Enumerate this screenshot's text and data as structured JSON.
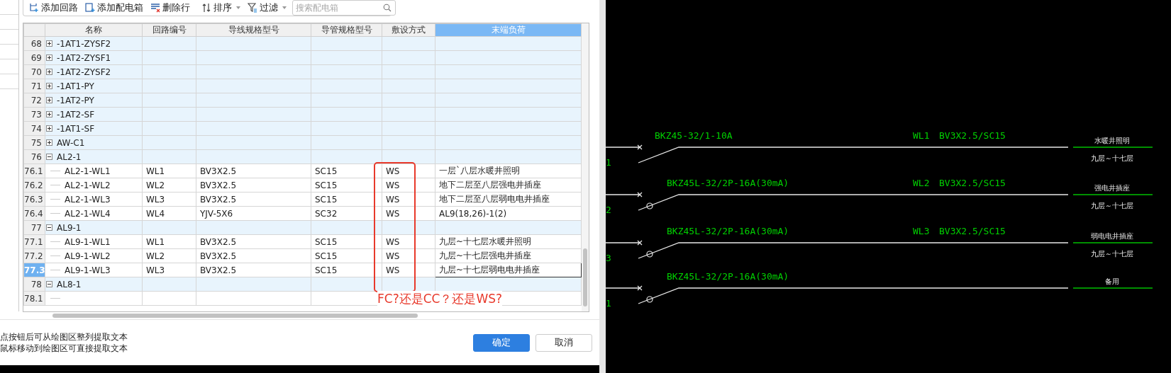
{
  "toolbar": {
    "buttons": [
      {
        "kind": "add-circuit",
        "label": "添加回路",
        "has_menu": false
      },
      {
        "kind": "add-box",
        "label": "添加配电箱",
        "has_menu": false
      },
      {
        "kind": "delete-row",
        "label": "删除行",
        "has_menu": false
      },
      {
        "kind": "sort",
        "label": "排序",
        "has_menu": true
      },
      {
        "kind": "filter",
        "label": "过滤",
        "has_menu": true
      }
    ],
    "search": {
      "placeholder": "搜索配电箱"
    }
  },
  "table": {
    "columns": [
      {
        "label": "名称",
        "selected": false
      },
      {
        "label": "回路编号",
        "selected": false
      },
      {
        "label": "导线规格型号",
        "selected": false
      },
      {
        "label": "导管规格型号",
        "selected": false
      },
      {
        "label": "敷设方式",
        "selected": false
      },
      {
        "label": "末端负荷",
        "selected": true
      }
    ],
    "rows": [
      {
        "number": "68",
        "kind": "group",
        "expanded": false,
        "name": "-1AT1-ZYSF2",
        "selected": false
      },
      {
        "number": "69",
        "kind": "group",
        "expanded": false,
        "name": "-1AT2-ZYSF1",
        "selected": false
      },
      {
        "number": "70",
        "kind": "group",
        "expanded": false,
        "name": "-1AT2-ZYSF2",
        "selected": false
      },
      {
        "number": "71",
        "kind": "group",
        "expanded": false,
        "name": "-1AT1-PY",
        "selected": false
      },
      {
        "number": "72",
        "kind": "group",
        "expanded": false,
        "name": "-1AT2-PY",
        "selected": false
      },
      {
        "number": "73",
        "kind": "group",
        "expanded": false,
        "name": "-1AT2-SF",
        "selected": false
      },
      {
        "number": "74",
        "kind": "group",
        "expanded": false,
        "name": "-1AT1-SF",
        "selected": false
      },
      {
        "number": "75",
        "kind": "group",
        "expanded": false,
        "name": "AW-C1",
        "selected": false
      },
      {
        "number": "76",
        "kind": "group",
        "expanded": true,
        "name": "AL2-1",
        "selected": false
      },
      {
        "number": "76.1",
        "kind": "child",
        "name": "AL2-1-WL1",
        "selected": false,
        "cells": [
          "WL1",
          "BV3X2.5",
          "SC15",
          "WS",
          "一层`八层水暖井照明"
        ]
      },
      {
        "number": "76.2",
        "kind": "child",
        "name": "AL2-1-WL2",
        "selected": false,
        "cells": [
          "WL2",
          "BV3X2.5",
          "SC15",
          "WS",
          "地下二层至八层强电井插座"
        ]
      },
      {
        "number": "76.3",
        "kind": "child",
        "name": "AL2-1-WL3",
        "selected": false,
        "cells": [
          "WL3",
          "BV3X2.5",
          "SC15",
          "WS",
          "地下二层至八层弱电电井插座"
        ]
      },
      {
        "number": "76.4",
        "kind": "child",
        "name": "AL2-1-WL4",
        "selected": false,
        "cells": [
          "WL4",
          "YJV-5X6",
          "SC32",
          "WS",
          "AL9(18,26)-1(2)"
        ]
      },
      {
        "number": "77",
        "kind": "group",
        "expanded": true,
        "name": "AL9-1",
        "selected": false
      },
      {
        "number": "77.1",
        "kind": "child",
        "name": "AL9-1-WL1",
        "selected": false,
        "cells": [
          "WL1",
          "BV3X2.5",
          "SC15",
          "WS",
          "九层~十七层水暖井照明"
        ]
      },
      {
        "number": "77.2",
        "kind": "child",
        "name": "AL9-1-WL2",
        "selected": false,
        "cells": [
          "WL2",
          "BV3X2.5",
          "SC15",
          "WS",
          "九层~十七层强电井插座"
        ]
      },
      {
        "number": "77.3",
        "kind": "child",
        "name": "AL9-1-WL3",
        "selected": true,
        "cells": [
          "WL3",
          "BV3X2.5",
          "SC15",
          "WS",
          "九层~十七层弱电电井插座"
        ]
      },
      {
        "number": "78",
        "kind": "group",
        "expanded": true,
        "name": "AL8-1",
        "selected": false
      },
      {
        "number": "78.1",
        "kind": "child",
        "selected": false
      }
    ]
  },
  "annotation": {
    "note": "FC?还是CC？还是WS?"
  },
  "hints": [
    "点按钮后可从绘图区整列提取文本",
    "鼠标移动到绘图区可直接提取文本"
  ],
  "buttons": [
    {
      "label": "确定",
      "primary": true
    },
    {
      "label": "取消",
      "primary": false
    }
  ],
  "drawing": {
    "circuits": [
      {
        "line_number": "1",
        "kind": "breaker",
        "breaker": "BKZ45-32/1-10A",
        "circuit": "WL1",
        "cable": "BV3X2.5/SC15",
        "load": "水暖井照明",
        "floors": "九层～十七层"
      },
      {
        "line_number": "2",
        "kind": "rcd",
        "breaker": "BKZ45L-32/2P-16A(30mA)",
        "circuit": "WL2",
        "cable": "BV3X2.5/SC15",
        "load": "强电井插座",
        "floors": "九层～十七层"
      },
      {
        "line_number": "3",
        "kind": "rcd",
        "breaker": "BKZ45L-32/2P-16A(30mA)",
        "circuit": "WL3",
        "cable": "BV3X2.5/SC15",
        "load": "弱电电井插座",
        "floors": "九层～十七层"
      },
      {
        "line_number": "1",
        "kind": "rcd",
        "breaker": "BKZ45L-32/2P-16A(30mA)",
        "load": "备用"
      }
    ]
  }
}
